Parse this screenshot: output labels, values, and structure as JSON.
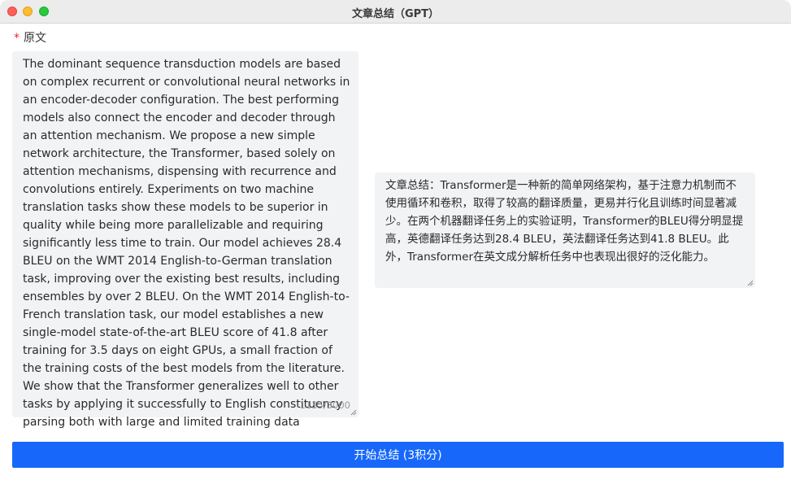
{
  "window": {
    "title": "文章总结（GPT）"
  },
  "form": {
    "source_required_mark": "*",
    "source_label": "原文",
    "source_text": "The dominant sequence transduction models are based on complex recurrent or convolutional neural networks in an encoder-decoder configuration. The best performing models also connect the encoder and decoder through an attention mechanism. We propose a new simple network architecture, the Transformer, based solely on attention mechanisms, dispensing with recurrence and convolutions entirely. Experiments on two machine translation tasks show these models to be superior in quality while being more parallelizable and requiring significantly less time to train. Our model achieves 28.4 BLEU on the WMT 2014 English-to-German translation task, improving over the existing best results, including ensembles by over 2 BLEU. On the WMT 2014 English-to-French translation task, our model establishes a new single-model state-of-the-art BLEU score of 41.8 after training for 3.5 days on eight GPUs, a small fraction of the training costs of the best models from the literature. We show that the Transformer generalizes well to other tasks by applying it successfully to English constituency parsing both with large and limited training data",
    "char_count": "1135/3000",
    "summary_text": "文章总结：Transformer是一种新的简单网络架构，基于注意力机制而不使用循环和卷积，取得了较高的翻译质量，更易并行化且训练时间显著减少。在两个机器翻译任务上的实验证明，Transformer的BLEU得分明显提高，英德翻译任务达到28.4 BLEU，英法翻译任务达到41.8 BLEU。此外，Transformer在英文成分解析任务中也表现出很好的泛化能力。",
    "start_button_label": "开始总结 (3积分)"
  },
  "colors": {
    "accent": "#1768fa",
    "required": "#f5222d",
    "field_bg": "#f2f3f5"
  }
}
